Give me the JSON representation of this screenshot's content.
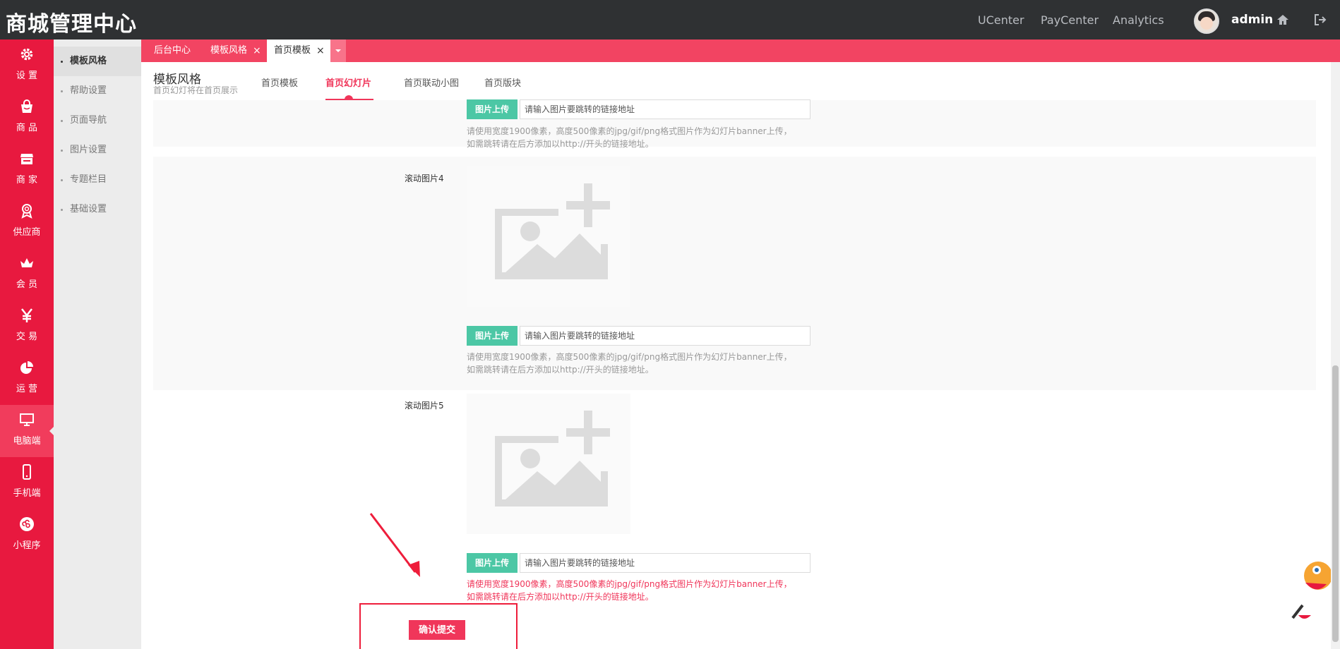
{
  "header": {
    "brand": "商城管理中心",
    "links": [
      "UCenter",
      "PayCenter",
      "Analytics"
    ],
    "user": "admin",
    "icons": [
      "avatar",
      "home-icon",
      "logout-icon"
    ]
  },
  "sidebar": {
    "items": [
      {
        "label": "设 置",
        "icon": "gear-icon"
      },
      {
        "label": "商 品",
        "icon": "shopping-bag-icon"
      },
      {
        "label": "商 家",
        "icon": "store-icon"
      },
      {
        "label": "供应商",
        "icon": "badge-icon"
      },
      {
        "label": "会 员",
        "icon": "crown-icon"
      },
      {
        "label": "交 易",
        "icon": "yen-icon"
      },
      {
        "label": "运 营",
        "icon": "pie-chart-icon"
      },
      {
        "label": "电脑端",
        "icon": "monitor-icon",
        "active": true
      },
      {
        "label": "手机端",
        "icon": "mobile-icon"
      },
      {
        "label": "小程序",
        "icon": "miniprogram-icon"
      }
    ]
  },
  "subnav": {
    "items": [
      {
        "label": "模板风格",
        "active": true
      },
      {
        "label": "帮助设置"
      },
      {
        "label": "页面导航"
      },
      {
        "label": "图片设置"
      },
      {
        "label": "专题栏目"
      },
      {
        "label": "基础设置"
      }
    ]
  },
  "tabs": [
    {
      "label": "后台中心"
    },
    {
      "label": "模板风格",
      "close": "×"
    },
    {
      "label": "首页模板",
      "close": "×",
      "active": true
    }
  ],
  "page": {
    "title": "模板风格",
    "subtitle": "首页幻灯将在首页展示",
    "subtabs": [
      {
        "label": "首页模板"
      },
      {
        "label": "首页幻灯片",
        "active": true
      },
      {
        "label": "首页联动小图"
      },
      {
        "label": "首页版块"
      }
    ]
  },
  "form": {
    "upload_label": "图片上传",
    "url_placeholder": "请输入图片要跳转的链接地址",
    "hint_line1": "请使用宽度1900像素，高度500像素的jpg/gif/png格式图片作为幻灯片banner上传，",
    "hint_line2": "如需跳转请在后方添加以http://开头的链接地址。",
    "slides": [
      {
        "label": "滚动图片4"
      },
      {
        "label": "滚动图片5"
      }
    ],
    "submit_label": "确认提交"
  },
  "colors": {
    "sidebar": "#e8193f",
    "tabstrip": "#f24462",
    "accent": "#f0365a",
    "upload": "#4cc7a5",
    "topbar": "#2f3133"
  }
}
